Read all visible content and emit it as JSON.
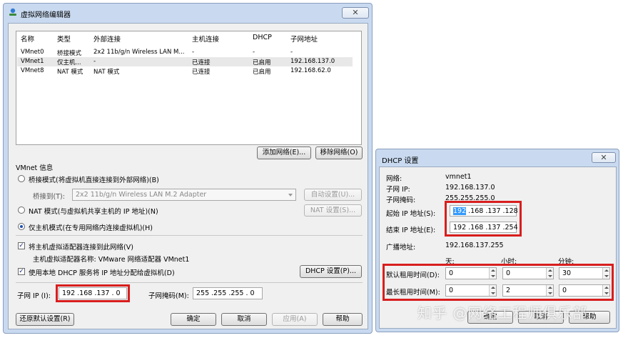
{
  "editor": {
    "title": "虚拟网络编辑器",
    "close": "✕",
    "columns": [
      "名称",
      "类型",
      "外部连接",
      "主机连接",
      "DHCP",
      "子网地址"
    ],
    "rows": [
      {
        "name": "VMnet0",
        "type": "桥接模式",
        "external": "2x2 11b/g/n Wireless LAN M...",
        "host": "-",
        "dhcp": "-",
        "subnet": "-"
      },
      {
        "name": "VMnet1",
        "type": "仅主机...",
        "external": "-",
        "host": "已连接",
        "dhcp": "已启用",
        "subnet": "192.168.137.0"
      },
      {
        "name": "VMnet8",
        "type": "NAT 模式",
        "external": "NAT 模式",
        "host": "已连接",
        "dhcp": "已启用",
        "subnet": "192.168.62.0"
      }
    ],
    "add_network": "添加网络(E)...",
    "remove_network": "移除网络(O)",
    "vmnet_info": "VMnet 信息",
    "bridge_mode": "桥接模式(将虚拟机直接连接到外部网络)(B)",
    "bridge_to_label": "桥接到(T):",
    "bridge_to_value": "2x2 11b/g/n Wireless LAN M.2 Adapter",
    "auto_settings": "自动设置(U)...",
    "nat_mode": "NAT 模式(与虚拟机共享主机的 IP 地址)(N)",
    "nat_settings": "NAT 设置(S)...",
    "host_only_mode": "仅主机模式(在专用网络内连接虚拟机)(H)",
    "connect_adapter": "将主机虚拟适配器连接到此网络(V)",
    "adapter_name": "主机虚拟适配器名称: VMware 网络适配器 VMnet1",
    "use_dhcp": "使用本地 DHCP 服务将 IP 地址分配给虚拟机(D)",
    "dhcp_settings": "DHCP 设置(P)...",
    "subnet_ip_label": "子网 IP (I):",
    "subnet_ip": "192 .168 .137 . 0",
    "subnet_mask_label": "子网掩码(M):",
    "subnet_mask": "255 .255 .255 . 0",
    "restore_defaults": "还原默认设置(R)",
    "ok": "确定",
    "cancel": "取消",
    "apply": "应用(A)",
    "help": "帮助"
  },
  "dhcp": {
    "title": "DHCP 设置",
    "close": "✕",
    "network_label": "网络:",
    "network": "vmnet1",
    "subnet_ip_label": "子网 IP:",
    "subnet_ip": "192.168.137.0",
    "subnet_mask_label": "子网掩码:",
    "subnet_mask": "255.255.255.0",
    "start_ip_label": "起始 IP 地址(S):",
    "start_ip_first": "192",
    "start_ip_rest": " .168 .137 .128",
    "end_ip_label": "结束 IP 地址(E):",
    "end_ip": "192 .168 .137 .254",
    "broadcast_label": "广播地址:",
    "broadcast": "192.168.137.255",
    "days_header": "天:",
    "hours_header": "小时:",
    "minutes_header": "分钟:",
    "default_lease_label": "默认租用时间(D):",
    "default_lease": [
      "0",
      "0",
      "30"
    ],
    "max_lease_label": "最长租用时间(M):",
    "max_lease": [
      "0",
      "2",
      "0"
    ],
    "ok": "确定",
    "cancel": "取消",
    "help": "帮助"
  },
  "watermark": "知乎 @网络工程师俱乐部",
  "colors": {
    "highlight_red": "#d81e1e",
    "selection_blue": "#3399ff",
    "window_frame": "#c9daf0"
  }
}
